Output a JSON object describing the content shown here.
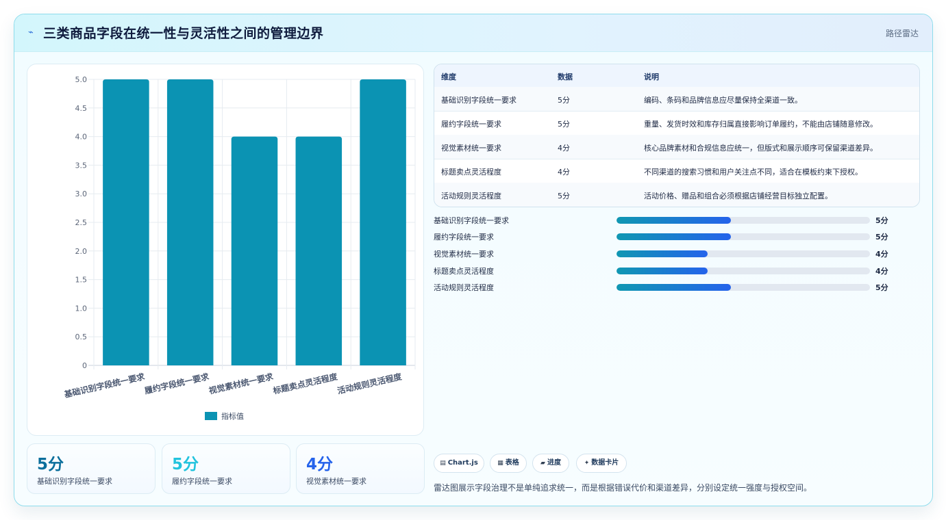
{
  "header": {
    "title": "三类商品字段在统一性与灵活性之间的管理边界",
    "tag": "路径雷达",
    "logo_icon": "spark-icon"
  },
  "chart_data": {
    "type": "bar",
    "categories": [
      "基础识别字段统一要求",
      "履约字段统一要求",
      "视觉素材统一要求",
      "标题卖点灵活程度",
      "活动规则灵活程度"
    ],
    "series": [
      {
        "name": "指标值",
        "values": [
          5,
          5,
          4,
          4,
          5
        ]
      }
    ],
    "ylim": [
      0,
      5
    ],
    "yticks": [
      "0",
      "0.5",
      "1.0",
      "1.5",
      "2.0",
      "2.5",
      "3.0",
      "3.5",
      "4.0",
      "4.5",
      "5.0"
    ],
    "grid": true,
    "legend": "bottom",
    "bar_color": "#0b93b3"
  },
  "kpis": [
    {
      "value": "5分",
      "label": "基础识别字段统一要求",
      "color": "#0b6f9c"
    },
    {
      "value": "5分",
      "label": "履约字段统一要求",
      "color": "#22c3dd"
    },
    {
      "value": "4分",
      "label": "视觉素材统一要求",
      "color": "#2563eb"
    }
  ],
  "table": {
    "headers": [
      "维度",
      "数据",
      "说明"
    ],
    "rows": [
      [
        "基础识别字段统一要求",
        "5分",
        "编码、条码和品牌信息应尽量保持全渠道一致。"
      ],
      [
        "履约字段统一要求",
        "5分",
        "重量、发货时效和库存归属直接影响订单履约，不能由店铺随意修改。"
      ],
      [
        "视觉素材统一要求",
        "4分",
        "核心品牌素材和合规信息应统一，但版式和展示顺序可保留渠道差异。"
      ],
      [
        "标题卖点灵活程度",
        "4分",
        "不同渠道的搜索习惯和用户关注点不同，适合在模板约束下授权。"
      ],
      [
        "活动规则灵活程度",
        "5分",
        "活动价格、赠品和组合必须根据店铺经营目标独立配置。"
      ]
    ]
  },
  "progress": [
    {
      "label": "基础识别字段统一要求",
      "value": "5分",
      "fraction": 0.45
    },
    {
      "label": "履约字段统一要求",
      "value": "5分",
      "fraction": 0.45
    },
    {
      "label": "视觉素材统一要求",
      "value": "4分",
      "fraction": 0.36
    },
    {
      "label": "标题卖点灵活程度",
      "value": "4分",
      "fraction": 0.36
    },
    {
      "label": "活动规则灵活程度",
      "value": "5分",
      "fraction": 0.45
    }
  ],
  "chips": [
    {
      "icon": "chart-icon",
      "glyph": "▤",
      "label": "Chart.js"
    },
    {
      "icon": "table-icon",
      "glyph": "▦",
      "label": "表格"
    },
    {
      "icon": "progress-icon",
      "glyph": "▰",
      "label": "进度"
    },
    {
      "icon": "card-icon",
      "glyph": "✦",
      "label": "数据卡片"
    }
  ],
  "footnote": "雷达图展示字段治理不是单纯追求统一，而是根据错误代价和渠道差异，分别设定统一强度与授权空间。"
}
